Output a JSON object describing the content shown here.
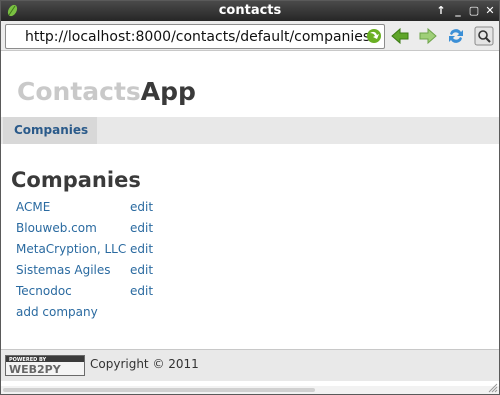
{
  "window": {
    "title": "contacts"
  },
  "toolbar": {
    "url": "http://localhost:8000/contacts/default/companies"
  },
  "brand": {
    "light": "Contacts",
    "dark": "App"
  },
  "nav": {
    "items": [
      {
        "label": "Companies"
      }
    ]
  },
  "main": {
    "title": "Companies",
    "companies": [
      {
        "name": "ACME",
        "edit": "edit"
      },
      {
        "name": "Blouweb.com",
        "edit": "edit"
      },
      {
        "name": "MetaCryption, LLC",
        "edit": "edit"
      },
      {
        "name": "Sistemas Agiles",
        "edit": "edit"
      },
      {
        "name": "Tecnodoc",
        "edit": "edit"
      }
    ],
    "add_label": "add company"
  },
  "footer": {
    "badge_top": "POWERED BY",
    "badge_main": "WEB2PY",
    "copyright": "Copyright © 2011"
  },
  "colors": {
    "link": "#2a6aa0",
    "titlebar": "#2b2b2b",
    "nav_bg": "#e8e8e8"
  },
  "icons": [
    "app-leaf-icon",
    "go-arrow-icon",
    "back-arrow-icon",
    "forward-arrow-icon",
    "reload-icon",
    "bookmark-icon"
  ]
}
